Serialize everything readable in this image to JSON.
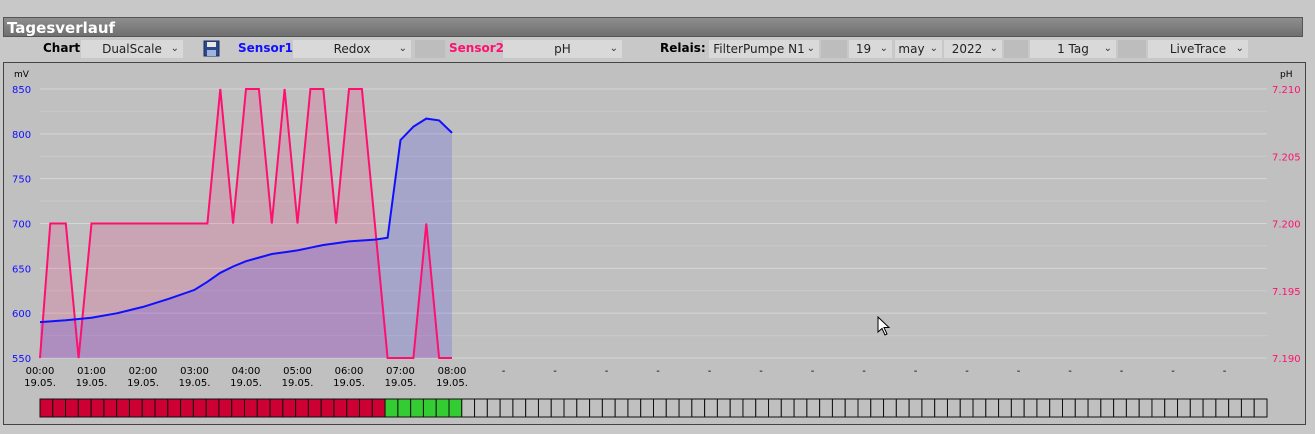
{
  "title": "Tagesverlauf",
  "toolbar": {
    "chart_label": "Chart:",
    "chart_value": "DualScale",
    "sensor1_label": "Sensor1:",
    "sensor1_value": "Redox",
    "sensor2_label": "Sensor2:",
    "sensor2_value": "pH",
    "relais_label": "Relais:",
    "relais_value": "FilterPumpe N1",
    "day": "19",
    "month": "may",
    "year": "2022",
    "range": "1 Tag",
    "mode": "LiveTrace"
  },
  "colors": {
    "sensor1": "#1010ff",
    "sensor2": "#ff1070",
    "relay_on": "#cc0033",
    "relay_active": "#33cc33",
    "relay_off": "#c0c0c0"
  },
  "chart_data": {
    "type": "line",
    "x_ticks": [
      "00:00",
      "01:00",
      "02:00",
      "03:00",
      "04:00",
      "05:00",
      "06:00",
      "07:00",
      "08:00"
    ],
    "x_date": "19.05.",
    "x_placeholder": "-",
    "x_placeholder_count": 15,
    "y_left": {
      "label": "mV",
      "ticks": [
        550,
        600,
        650,
        700,
        750,
        800,
        850
      ],
      "range": [
        550,
        850
      ]
    },
    "y_right": {
      "label": "pH",
      "ticks": [
        "7.190",
        "7.195",
        "7.200",
        "7.205",
        "7.210"
      ],
      "range": [
        7.19,
        7.21
      ]
    },
    "x_range_hours": [
      0,
      24
    ],
    "grid": true,
    "series": [
      {
        "name": "Redox",
        "axis": "left",
        "x": [
          0,
          0.5,
          1,
          1.5,
          2,
          2.5,
          3,
          3.25,
          3.5,
          3.75,
          4,
          4.25,
          4.5,
          4.75,
          5,
          5.25,
          5.5,
          5.75,
          6,
          6.25,
          6.5,
          6.75,
          7,
          7.25,
          7.5,
          7.75,
          8
        ],
        "y": [
          590,
          592,
          595,
          600,
          607,
          616,
          626,
          635,
          645,
          652,
          658,
          662,
          666,
          668,
          670,
          673,
          676,
          678,
          680,
          681,
          682,
          684,
          793,
          808,
          817,
          815,
          801
        ]
      },
      {
        "name": "pH",
        "axis": "right",
        "x": [
          0,
          0.2,
          0.5,
          0.75,
          1,
          3.25,
          3.5,
          3.75,
          4,
          4.25,
          4.5,
          4.75,
          5,
          5.25,
          5.5,
          5.75,
          6,
          6.25,
          6.5,
          6.75,
          7,
          7.25,
          7.5,
          7.75,
          8
        ],
        "y": [
          7.19,
          7.2,
          7.2,
          7.19,
          7.2,
          7.2,
          7.21,
          7.2,
          7.21,
          7.21,
          7.2,
          7.21,
          7.2,
          7.21,
          7.21,
          7.2,
          7.21,
          7.21,
          7.2,
          7.19,
          7.19,
          7.19,
          7.2,
          7.19,
          7.19
        ]
      }
    ],
    "relay": {
      "total_cells": 96,
      "on_cells": 27,
      "active_cells": 6
    }
  }
}
